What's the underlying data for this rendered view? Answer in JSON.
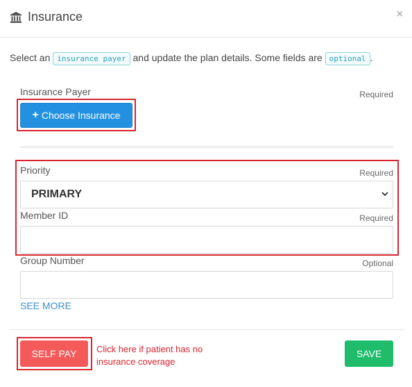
{
  "modal": {
    "title": "Insurance",
    "close_glyph": "×",
    "icon": "bank-icon"
  },
  "intro": {
    "part1": "Select an ",
    "code1": "insurance payer",
    "part2": " and update the plan details. Some fields are ",
    "code2": "optional",
    "part3": "."
  },
  "insurance_payer": {
    "label": "Insurance Payer",
    "requirement": "Required",
    "button_plus": "+",
    "button_label": "Choose Insurance"
  },
  "priority": {
    "label": "Priority",
    "requirement": "Required",
    "selected": "PRIMARY"
  },
  "member_id": {
    "label": "Member ID",
    "requirement": "Required",
    "value": ""
  },
  "group_number": {
    "label": "Group Number",
    "requirement": "Optional",
    "value": ""
  },
  "see_more": "SEE MORE",
  "footer": {
    "self_pay_label": "SELF PAY",
    "note": "Click here if patient has no insurance coverage",
    "save_label": "SAVE"
  },
  "colors": {
    "primary_blue": "#2491e0",
    "self_pay_red": "#f45a5a",
    "save_green": "#1fbc6b",
    "highlight_red": "#d9242f",
    "link_blue": "#3b8fd0"
  }
}
